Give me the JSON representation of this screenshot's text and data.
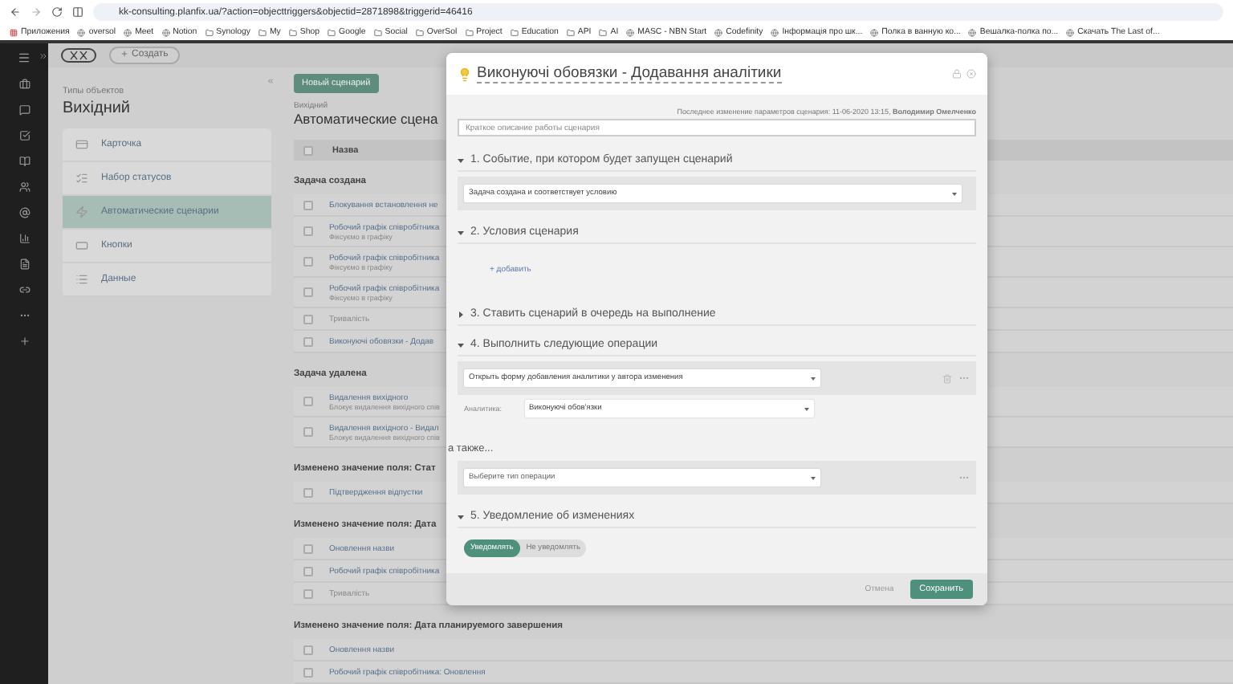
{
  "browser": {
    "url": "kk-consulting.planfix.ua/?action=objecttriggers&objectid=2871898&triggerid=46416",
    "bookmarks": [
      {
        "label": "Приложения",
        "kind": "apps"
      },
      {
        "label": "oversol",
        "kind": "site"
      },
      {
        "label": "Meet",
        "kind": "site"
      },
      {
        "label": "Notion",
        "kind": "site"
      },
      {
        "label": "Synology",
        "kind": "folder"
      },
      {
        "label": "My",
        "kind": "folder"
      },
      {
        "label": "Shop",
        "kind": "folder"
      },
      {
        "label": "Google",
        "kind": "folder"
      },
      {
        "label": "Social",
        "kind": "folder"
      },
      {
        "label": "OverSol",
        "kind": "folder"
      },
      {
        "label": "Project",
        "kind": "folder"
      },
      {
        "label": "Education",
        "kind": "folder"
      },
      {
        "label": "API",
        "kind": "folder"
      },
      {
        "label": "AI",
        "kind": "folder"
      },
      {
        "label": "MASC - NBN Start",
        "kind": "site"
      },
      {
        "label": "Codefinity",
        "kind": "site"
      },
      {
        "label": "Інформація про шк...",
        "kind": "site"
      },
      {
        "label": "Полка в ванную ко...",
        "kind": "site"
      },
      {
        "label": "Вешалка-полка по...",
        "kind": "site"
      },
      {
        "label": "Скачать The Last of...",
        "kind": "site"
      }
    ]
  },
  "header": {
    "create_button": "Создать"
  },
  "object_types": {
    "caption": "Типы объектов",
    "title": "Вихідний",
    "items": [
      {
        "label": "Карточка",
        "selected": false
      },
      {
        "label": "Набор статусов",
        "selected": false
      },
      {
        "label": "Автоматические сценарии",
        "selected": true
      },
      {
        "label": "Кнопки",
        "selected": false
      },
      {
        "label": "Данные",
        "selected": false
      }
    ]
  },
  "main": {
    "new_button": "Новый сценарий",
    "breadcrumb": "Вихідний",
    "title": "Автоматические сцена",
    "column": "Назва",
    "header_checked": false,
    "groups": [
      {
        "title": "Задача создана",
        "rows": [
          {
            "name": "Блокування встановлення не",
            "disabled": false,
            "checked": false
          },
          {
            "name": "Робочий графік співробітника",
            "note": "Фіксуємо в графіку",
            "disabled": false,
            "checked": false
          },
          {
            "name": "Робочий графік співробітника",
            "note": "Фіксуємо в графіку",
            "disabled": false,
            "checked": false
          },
          {
            "name": "Робочий графік співробітника",
            "note": "Фіксуємо в графіку",
            "disabled": false,
            "checked": false
          },
          {
            "name": "Тривалість",
            "disabled": true,
            "checked": false
          },
          {
            "name": "Виконуючі обовязки - Додав",
            "disabled": false,
            "checked": false
          }
        ]
      },
      {
        "title": "Задача удалена",
        "rows": [
          {
            "name": "Видалення вихідного",
            "note": "Блокує видалення вихідного спів",
            "disabled": false,
            "checked": false
          },
          {
            "name": "Видалення вихідного - Видал",
            "note": "Блокує видалення вихідного спів",
            "disabled": false,
            "checked": false
          }
        ]
      },
      {
        "title": "Изменено значение поля: Стат",
        "rows": [
          {
            "name": "Підтвердження відпустки",
            "disabled": false,
            "checked": false
          }
        ]
      },
      {
        "title": "Изменено значение поля: Дата",
        "rows": [
          {
            "name": "Оновлення назви",
            "disabled": false,
            "checked": false
          },
          {
            "name": "Робочий графік співробітника",
            "disabled": false,
            "checked": false
          },
          {
            "name": "Тривалість",
            "disabled": true,
            "checked": false
          }
        ]
      },
      {
        "title": "Изменено значение поля: Дата планируемого завершения",
        "rows": [
          {
            "name": "Оновлення назви",
            "disabled": false,
            "checked": false
          },
          {
            "name": "Робочий графік співробітника: Оновлення",
            "disabled": false,
            "checked": false
          }
        ]
      }
    ]
  },
  "modal": {
    "title": "Виконуючі обовязки - Додавання аналітики",
    "meta": "Последнее изменение параметров сценария: 11-06-2020 13:15,",
    "meta_author": "Володимир Омелченко",
    "description_placeholder": "Краткое описание работы сценария",
    "sections": [
      {
        "title": "1. Событие, при котором будет запущен сценарий",
        "expanded": true,
        "kind": "select",
        "value": "Задача создана и соответствует условию"
      },
      {
        "title": "2. Условия сценария",
        "expanded": true,
        "kind": "add",
        "link": "+ добавить"
      },
      {
        "title": "3. Ставить сценарий в очередь на выполнение",
        "expanded": false
      },
      {
        "title": "4. Выполнить следующие операции",
        "expanded": true,
        "kind": "operations",
        "operation": "Открыть форму добавления аналитики у автора изменения",
        "param_label": "Аналитика:",
        "param_value": "Виконуючі обов'язки",
        "also": "а также...",
        "next_placeholder": "Выберите тип операции"
      },
      {
        "title": "5. Уведомление об изменениях",
        "expanded": true,
        "kind": "notify",
        "options": [
          {
            "label": "Уведомлять",
            "selected": true
          },
          {
            "label": "Не уведомлять",
            "selected": false
          }
        ]
      }
    ],
    "cancel": "Отмена",
    "save": "Сохранить"
  }
}
